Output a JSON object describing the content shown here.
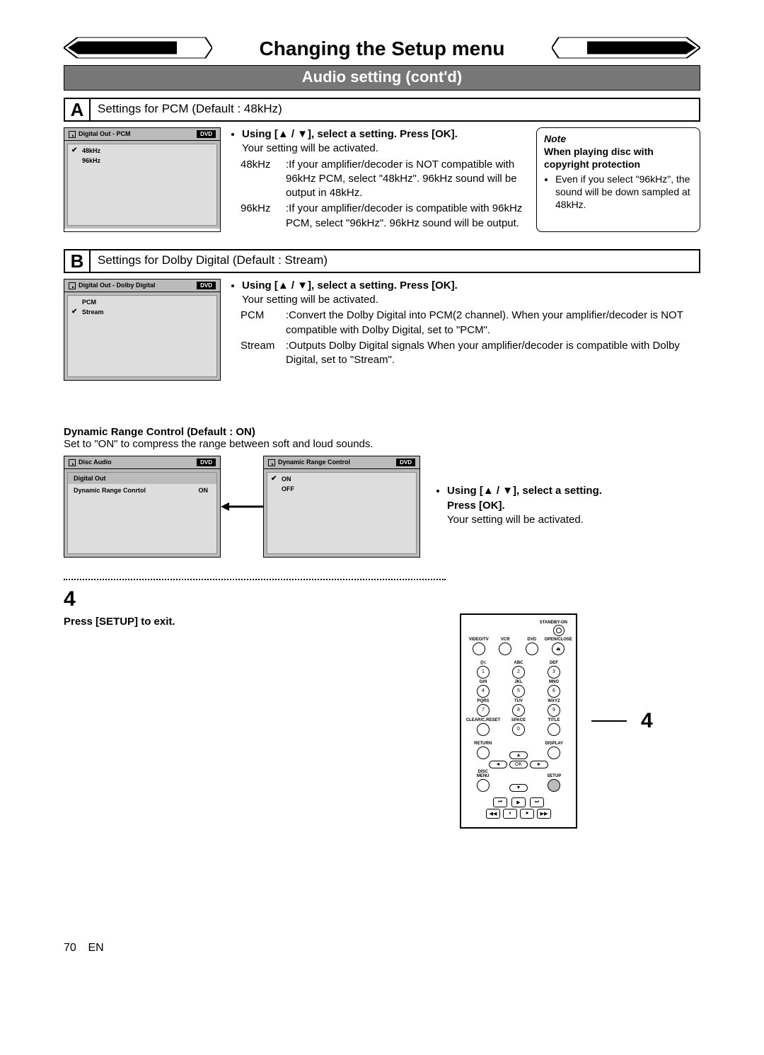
{
  "title": "Changing the Setup menu",
  "subtitle": "Audio setting (cont'd)",
  "sectionA": {
    "letter": "A",
    "heading": "Settings for PCM (Default : 48kHz)",
    "osd": {
      "title": "Digital Out - PCM",
      "tag": "DVD",
      "items": [
        {
          "label": "48kHz",
          "checked": true
        },
        {
          "label": "96kHz",
          "checked": false
        }
      ]
    },
    "instruction": "Using [▲ / ▼], select a setting. Press [OK].",
    "instruction_sub": "Your setting will be activated.",
    "defs": [
      {
        "term": "48kHz",
        "def": ":If your amplifier/decoder is NOT compatible with 96kHz PCM, select \"48kHz\". 96kHz sound will be output in 48kHz."
      },
      {
        "term": "96kHz",
        "def": ":If your amplifier/decoder is compatible with 96kHz PCM, select \"96kHz\". 96kHz sound will be output."
      }
    ],
    "note": {
      "title": "Note",
      "subtitle": "When playing disc with copyright protection",
      "bullet": "Even if you select \"96kHz\", the sound will be down sampled at 48kHz."
    }
  },
  "sectionB": {
    "letter": "B",
    "heading": "Settings for Dolby Digital (Default : Stream)",
    "osd": {
      "title": "Digital Out - Dolby Digital",
      "tag": "DVD",
      "items": [
        {
          "label": "PCM",
          "checked": false
        },
        {
          "label": "Stream",
          "checked": true
        }
      ]
    },
    "instruction": "Using [▲ / ▼], select a setting. Press [OK].",
    "instruction_sub": "Your setting will be activated.",
    "defs": [
      {
        "term": "PCM",
        "def": ":Convert the Dolby Digital into PCM(2 channel). When your amplifier/decoder is NOT compatible with Dolby Digital, set to \"PCM\"."
      },
      {
        "term": "Stream",
        "def": ":Outputs Dolby Digital signals When your amplifier/decoder is compatible with Dolby Digital, set to \"Stream\"."
      }
    ]
  },
  "drc": {
    "heading": "Dynamic Range Control (Default : ON)",
    "sub": "Set to \"ON\" to compress the range between soft and loud sounds.",
    "osd1": {
      "title": "Disc Audio",
      "tag": "DVD",
      "rows": [
        {
          "label": "Digital Out",
          "value": ""
        },
        {
          "label": "Dynamic Range Conrtol",
          "value": "ON"
        }
      ]
    },
    "osd2": {
      "title": "Dynamic Range Control",
      "tag": "DVD",
      "items": [
        {
          "label": "ON",
          "checked": true
        },
        {
          "label": "OFF",
          "checked": false
        }
      ]
    },
    "instruction": "Using [▲ / ▼], select a setting. Press [OK].",
    "instruction_sub": "Your setting will be activated."
  },
  "step4": {
    "num": "4",
    "text": "Press [SETUP] to exit.",
    "callout": "4"
  },
  "remote": {
    "standby": "STANDBY-ON",
    "row1": [
      "VIDEO/TV",
      "VCR",
      "DVD",
      "OPEN/CLOSE"
    ],
    "numlabels_r1": [
      "@/.",
      "ABC",
      "DEF"
    ],
    "nums_r1": [
      "1",
      "2",
      "3"
    ],
    "numlabels_r2": [
      "GHI",
      "JKL",
      "MNO"
    ],
    "nums_r2": [
      "4",
      "5",
      "6"
    ],
    "numlabels_r3": [
      "PQRS",
      "TUV",
      "WXYZ"
    ],
    "nums_r3": [
      "7",
      "8",
      "9"
    ],
    "row_bottom_lbls": [
      "CLEAR/C.RESET",
      "SPACE",
      "TITLE"
    ],
    "zero": "0",
    "return": "RETURN",
    "display": "DISPLAY",
    "ok": "OK",
    "discmenu": "DISC MENU",
    "setup": "SETUP",
    "arrows": {
      "up": "▲",
      "down": "▼",
      "left": "◄",
      "right": "►"
    },
    "transport1": [
      "⏮",
      "▶",
      "⏭"
    ],
    "transport2": [
      "◀◀",
      "⏸",
      "⏹",
      "▶▶"
    ]
  },
  "footer": {
    "page": "70",
    "lang": "EN"
  }
}
